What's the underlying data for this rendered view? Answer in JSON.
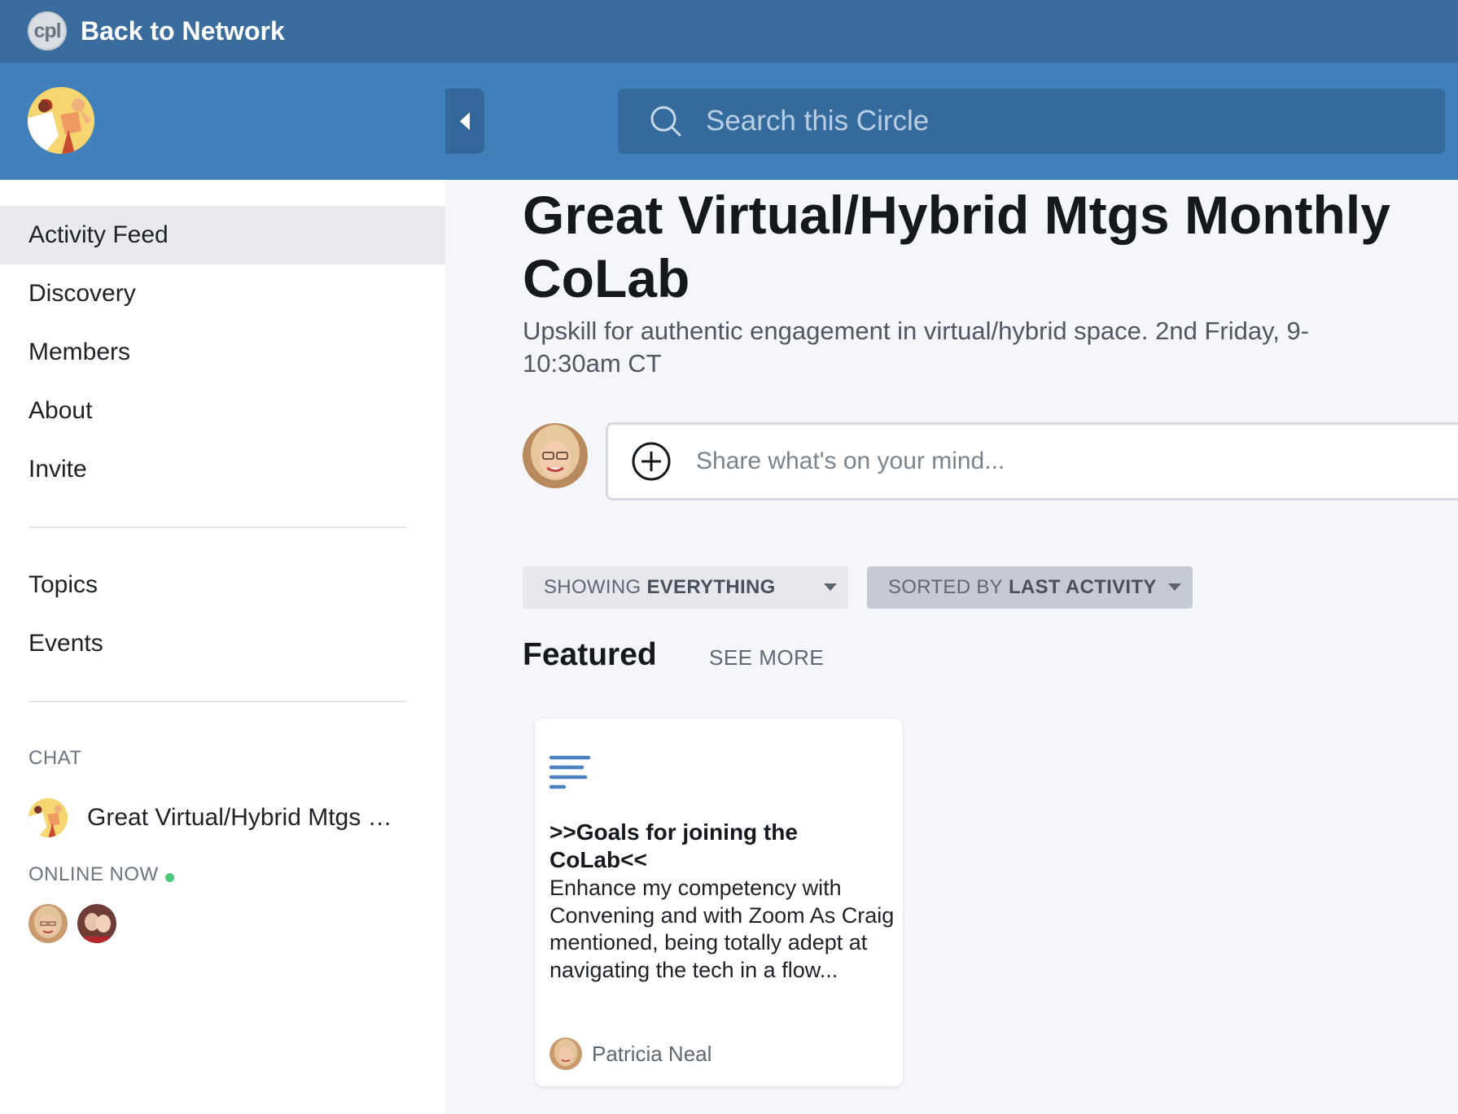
{
  "topbar": {
    "logo_text": "cpl",
    "back_label": "Back to Network"
  },
  "search": {
    "placeholder": "Search this Circle"
  },
  "sidebar": {
    "nav": [
      {
        "label": "Activity Feed",
        "active": true
      },
      {
        "label": "Discovery"
      },
      {
        "label": "Members"
      },
      {
        "label": "About"
      },
      {
        "label": "Invite"
      }
    ],
    "secondary_nav": [
      {
        "label": "Topics"
      },
      {
        "label": "Events"
      }
    ],
    "chat_heading": "CHAT",
    "chat_item": "Great Virtual/Hybrid Mtgs Monthly CoLab",
    "online_heading": "ONLINE NOW",
    "online_status_color": "#4fc97a"
  },
  "main": {
    "title": "Great Virtual/Hybrid Mtgs Monthly CoLab",
    "description": "Upskill for authentic engagement in virtual/hybrid space. 2nd Friday, 9-10:30am CT",
    "composer_placeholder": "Share what's on your mind...",
    "filter_showing": {
      "prefix": "SHOWING",
      "value": "EVERYTHING"
    },
    "filter_sort": {
      "prefix": "SORTED BY",
      "value": "LAST ACTIVITY"
    },
    "featured_heading": "Featured",
    "see_more": "SEE MORE",
    "featured_card": {
      "icon": "text-post-icon",
      "title": ">>Goals for joining the CoLab<<",
      "body": "Enhance my competency with Convening and with Zoom As Craig mentioned, being totally adept at navigating the tech in a flow...",
      "author": "Patricia Neal"
    }
  },
  "colors": {
    "topbar": "#3a6d9e",
    "header": "#3f7fba",
    "accent": "#4a82c0"
  }
}
